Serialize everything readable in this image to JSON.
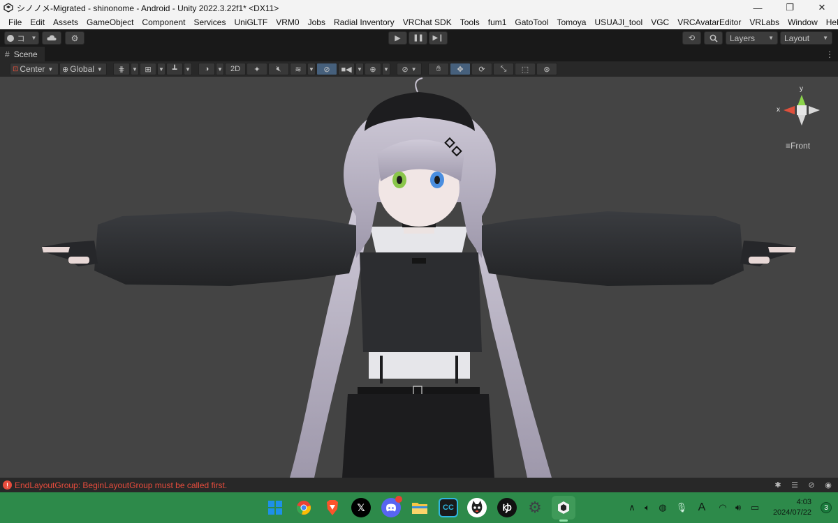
{
  "window": {
    "title": "シノノメ-Migrated - shinonome - Android - Unity 2022.3.22f1* <DX11>",
    "minimize_glyph": "—",
    "restore_glyph": "❐",
    "close_glyph": "✕"
  },
  "menu": [
    "File",
    "Edit",
    "Assets",
    "GameObject",
    "Component",
    "Services",
    "UniGLTF",
    "VRM0",
    "Jobs",
    "Radial Inventory",
    "VRChat SDK",
    "Tools",
    "fum1",
    "GatoTool",
    "Tomoya",
    "USUAJI_tool",
    "VGC",
    "VRCAvatarEditor",
    "VRLabs",
    "Window",
    "Help"
  ],
  "toolbar": {
    "account_label": "コ",
    "layers_label": "Layers",
    "layout_label": "Layout"
  },
  "scene": {
    "tab_label": "Scene",
    "pivot_label": "Center",
    "space_label": "Global",
    "mode_2d_label": "2D",
    "gizmo": {
      "x_label": "x",
      "y_label": "y",
      "view_label": "Front"
    }
  },
  "console": {
    "error_message": "EndLayoutGroup: BeginLayoutGroup must be called first."
  },
  "taskbar": {
    "time": "4:03",
    "date": "2024/07/22",
    "notification_count": "3",
    "ime_label": "A"
  },
  "colors": {
    "viewport_bg": "#444444",
    "error_red": "#e84c3d",
    "taskbar_green": "#2d8a4a",
    "gizmo_x": "#e0503c",
    "gizmo_y": "#8bd44a"
  }
}
